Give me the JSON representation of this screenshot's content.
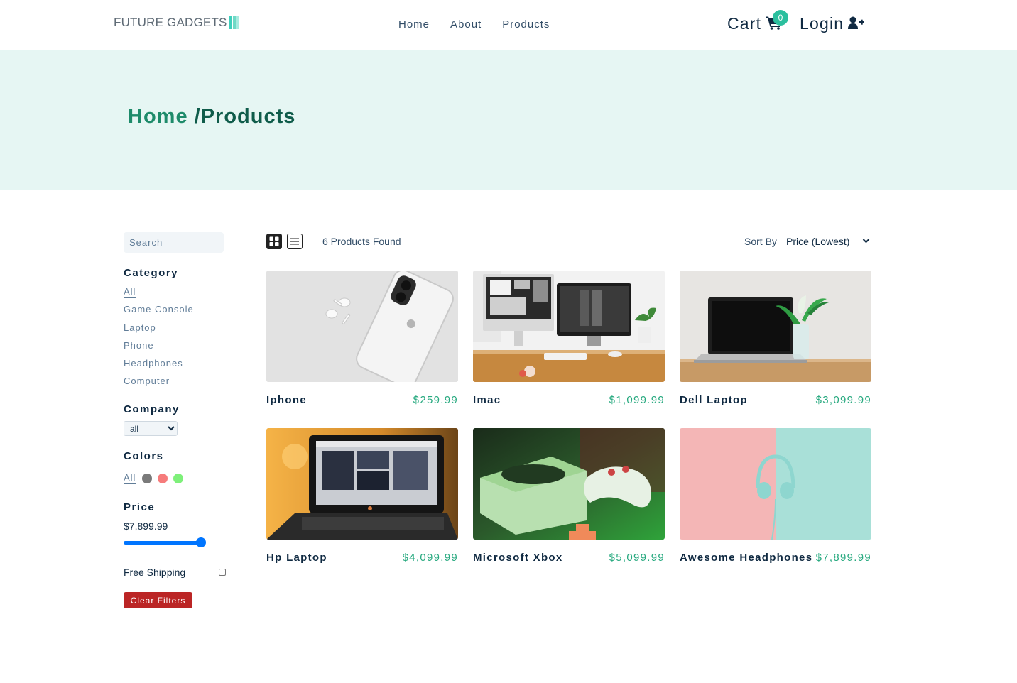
{
  "brand": {
    "logo_text": "FUTURE GADGETS",
    "logo_colors": [
      "#2caeba",
      "#3ecfbc",
      "#9be7d9"
    ]
  },
  "nav": {
    "links": [
      {
        "label": "Home"
      },
      {
        "label": "About"
      },
      {
        "label": "Products"
      }
    ],
    "cart_label": "Cart",
    "cart_count": "0",
    "login_label": "Login"
  },
  "hero": {
    "crumb_home": "Home",
    "crumb_current": "/Products"
  },
  "filters": {
    "search_placeholder": "Search",
    "category_heading": "Category",
    "categories": [
      {
        "label": "All"
      },
      {
        "label": "Game Console"
      },
      {
        "label": "Laptop"
      },
      {
        "label": "Phone"
      },
      {
        "label": "Headphones"
      },
      {
        "label": "Computer"
      }
    ],
    "company_heading": "Company",
    "company_selected": "all",
    "colors_heading": "Colors",
    "colors_all_label": "All",
    "colors": [
      "#7a7a7a",
      "#f67b7b",
      "#7ef07a"
    ],
    "price_heading": "Price",
    "price_value": "$7,899.99",
    "price_fraction": 0.92,
    "shipping_label": "Free Shipping",
    "clear_label": "Clear Filters"
  },
  "sort": {
    "found_text": "6 Products Found",
    "sort_label": "Sort By",
    "sort_selected": "Price (Lowest)"
  },
  "products": [
    {
      "name": "Iphone",
      "price": "$259.99"
    },
    {
      "name": "Imac",
      "price": "$1,099.99"
    },
    {
      "name": "Dell Laptop",
      "price": "$3,099.99"
    },
    {
      "name": "Hp Laptop",
      "price": "$4,099.99"
    },
    {
      "name": "Microsoft Xbox",
      "price": "$5,099.99"
    },
    {
      "name": "Awesome Headphones",
      "price": "$7,899.99"
    }
  ],
  "colors": {
    "accent": "#2caeba",
    "price_green": "#27a97f",
    "hero_bg": "#e6f6f3",
    "crumb_home": "#1e8b6a",
    "crumb_current": "#0f5c4a",
    "clear_red": "#bb2525"
  }
}
